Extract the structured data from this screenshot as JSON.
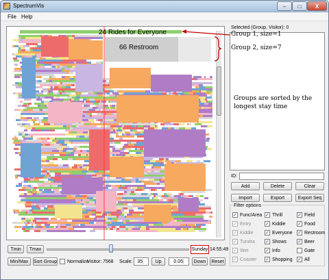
{
  "window": {
    "title": "SpectrumVis",
    "close_glyph": "X"
  },
  "menu": [
    "File",
    "Help"
  ],
  "selected_label": "Selected (Group, Visitor):  0",
  "annotations": {
    "rides": "24 Rides for Everyone",
    "restroom": "66 Restroom",
    "group1": "Group 1, size=1",
    "group2": "Group 2, size=7",
    "sorted": "Groups are sorted by the longest stay time"
  },
  "id_label": "ID:",
  "buttons": {
    "add": "Add",
    "delete": "Delete",
    "clear": "Clear",
    "import": "Import",
    "export": "Export",
    "export_seq": "Export Seq",
    "tmin": "Tmin",
    "tmax": "Tmax",
    "minmax": "Min/Max",
    "sort_group": "Sort Group",
    "up": "Up",
    "down": "Down",
    "reset": "Reset"
  },
  "filter": {
    "title": "Filter options",
    "items": [
      {
        "label": "Func/Area",
        "checked": true,
        "enabled": true
      },
      {
        "label": "Thrill",
        "checked": true,
        "enabled": true
      },
      {
        "label": "Field",
        "checked": true,
        "enabled": true
      },
      {
        "label": "Entry",
        "checked": true,
        "enabled": false
      },
      {
        "label": "Kiddie",
        "checked": true,
        "enabled": true
      },
      {
        "label": "Food",
        "checked": true,
        "enabled": true
      },
      {
        "label": "Kiddie",
        "checked": true,
        "enabled": false
      },
      {
        "label": "Everyone",
        "checked": true,
        "enabled": true
      },
      {
        "label": "Restroom",
        "checked": true,
        "enabled": true
      },
      {
        "label": "Tundra",
        "checked": true,
        "enabled": false
      },
      {
        "label": "Shows",
        "checked": true,
        "enabled": true
      },
      {
        "label": "Beer",
        "checked": true,
        "enabled": true
      },
      {
        "label": "Wet",
        "checked": true,
        "enabled": false
      },
      {
        "label": "Info",
        "checked": true,
        "enabled": true
      },
      {
        "label": "Gate",
        "checked": false,
        "enabled": true
      },
      {
        "label": "Coaster",
        "checked": true,
        "enabled": false
      },
      {
        "label": "Shopping",
        "checked": true,
        "enabled": true
      },
      {
        "label": "All",
        "checked": true,
        "enabled": true
      }
    ]
  },
  "time": {
    "day": "Sunday",
    "clock": "14:55:49"
  },
  "controls": {
    "normalize": "Normalize",
    "normalize_checked": false,
    "visitor_label": "Visitor:",
    "visitor": "7568",
    "scale_label": "Scale:",
    "scale": "35",
    "step": "0.05"
  },
  "colors": {
    "orange": "#f6a95f",
    "purple": "#b07cc6",
    "blue": "#6ea3d4",
    "red": "#ee6b6b",
    "green": "#8fcf6d",
    "yellow": "#f3e58f",
    "pink": "#f4b6c4",
    "gray": "#d9d9d9",
    "lavender": "#c9b6e3"
  }
}
